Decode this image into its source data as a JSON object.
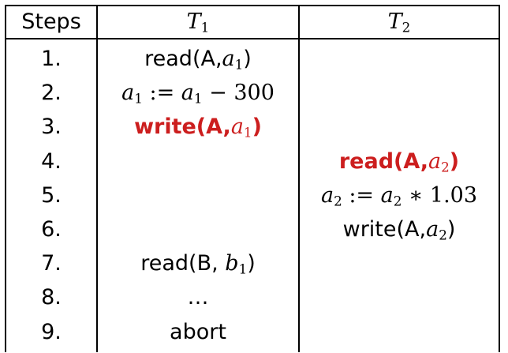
{
  "table": {
    "headers": {
      "steps": "Steps",
      "t1_base": "T",
      "t1_sub": "1",
      "t2_base": "T",
      "t2_sub": "2"
    },
    "rows": [
      {
        "step": "1.",
        "t1": [
          {
            "t": "read(A,"
          },
          {
            "m": "a"
          },
          {
            "s": "1"
          },
          {
            "t": ")"
          }
        ],
        "t2": [],
        "highlight": null
      },
      {
        "step": "2.",
        "t1": [
          {
            "m": "a"
          },
          {
            "s": "1"
          },
          {
            "u": " := "
          },
          {
            "m": "a"
          },
          {
            "s": "1"
          },
          {
            "u": " − 300"
          }
        ],
        "t2": [],
        "highlight": null
      },
      {
        "step": "3.",
        "t1": [
          {
            "t": "write(A,"
          },
          {
            "m": "a"
          },
          {
            "s": "1"
          },
          {
            "t": ")"
          }
        ],
        "t2": [],
        "highlight": "t1"
      },
      {
        "step": "4.",
        "t1": [],
        "t2": [
          {
            "t": "read(A,"
          },
          {
            "m": "a"
          },
          {
            "s": "2"
          },
          {
            "t": ")"
          }
        ],
        "highlight": "t2"
      },
      {
        "step": "5.",
        "t1": [],
        "t2": [
          {
            "m": "a"
          },
          {
            "s": "2"
          },
          {
            "u": " := "
          },
          {
            "m": "a"
          },
          {
            "s": "2"
          },
          {
            "u": " ∗ 1.03"
          }
        ],
        "highlight": null
      },
      {
        "step": "6.",
        "t1": [],
        "t2": [
          {
            "t": "write(A,"
          },
          {
            "m": "a"
          },
          {
            "s": "2"
          },
          {
            "t": ")"
          }
        ],
        "highlight": null
      },
      {
        "step": "7.",
        "t1": [
          {
            "t": "read(B, "
          },
          {
            "m": "b"
          },
          {
            "s": "1"
          },
          {
            "t": ")"
          }
        ],
        "t2": [],
        "highlight": null
      },
      {
        "step": "8.",
        "t1": [
          {
            "t": "…"
          }
        ],
        "t2": [],
        "highlight": null
      },
      {
        "step": "9.",
        "t1": [
          {
            "t": "abort"
          }
        ],
        "t2": [],
        "highlight": null
      }
    ]
  },
  "colors": {
    "highlight": "#cc1e1e",
    "text": "#000000",
    "rule": "#000000"
  }
}
